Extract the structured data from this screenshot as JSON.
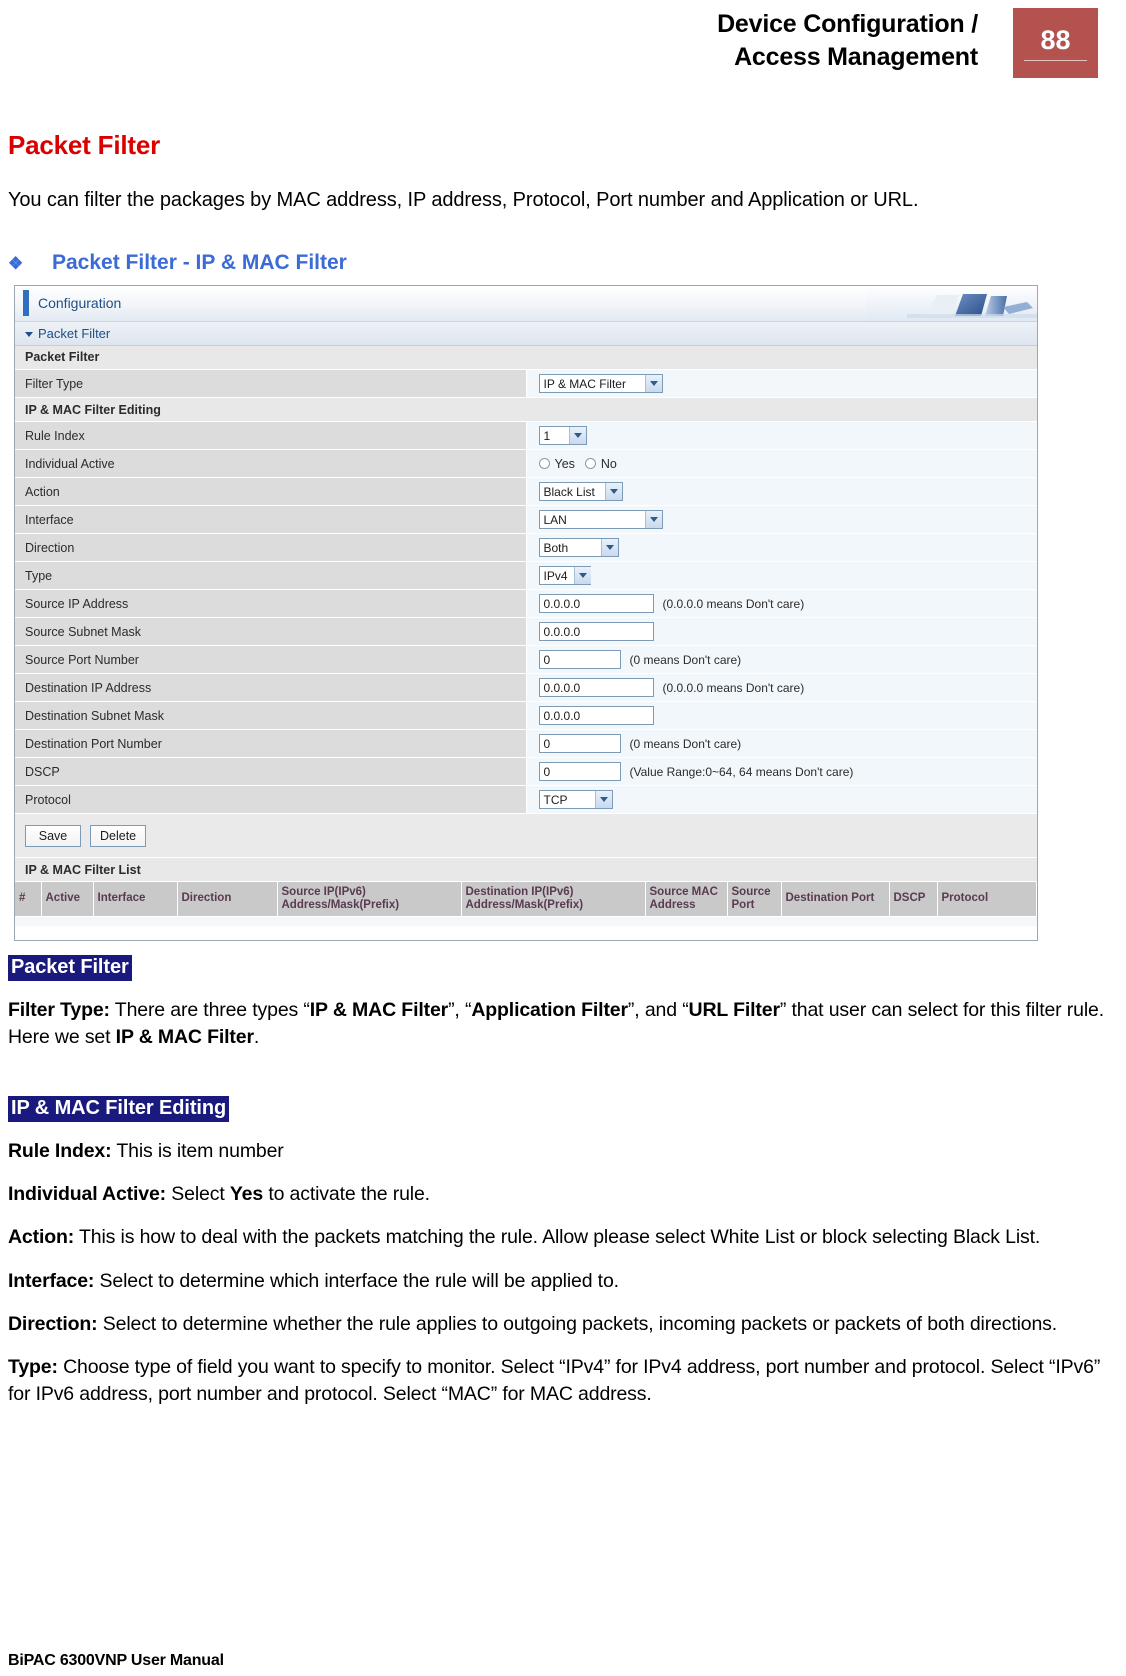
{
  "header": {
    "title": "Device Configuration /\nAccess Management",
    "page_number": "88"
  },
  "section": {
    "title": "Packet Filter",
    "intro": "You can filter the packages by MAC address, IP address, Protocol, Port number and Application or URL.",
    "bullet_marker": "❖",
    "bullet_title": "Packet Filter - IP & MAC Filter"
  },
  "screenshot": {
    "topbar_label": "Configuration",
    "panel_title": "Packet Filter",
    "groups": {
      "packet_filter": "Packet Filter",
      "filter_editing": "IP & MAC Filter Editing",
      "filter_list": "IP & MAC Filter List"
    },
    "rows": {
      "filter_type": {
        "label": "Filter Type",
        "value": "IP & MAC Filter"
      },
      "rule_index": {
        "label": "Rule Index",
        "value": "1"
      },
      "individual_active": {
        "label": "Individual Active",
        "yes": "Yes",
        "no": "No"
      },
      "action": {
        "label": "Action",
        "value": "Black List"
      },
      "interface": {
        "label": "Interface",
        "value": "LAN"
      },
      "direction": {
        "label": "Direction",
        "value": "Both"
      },
      "type": {
        "label": "Type",
        "value": "IPv4"
      },
      "source_ip": {
        "label": "Source IP Address",
        "value": "0.0.0.0",
        "hint": "(0.0.0.0 means Don't care)"
      },
      "source_mask": {
        "label": "Source Subnet Mask",
        "value": "0.0.0.0"
      },
      "source_port": {
        "label": "Source Port Number",
        "value": "0",
        "hint": "(0 means Don't care)"
      },
      "dest_ip": {
        "label": "Destination IP Address",
        "value": "0.0.0.0",
        "hint": "(0.0.0.0 means Don't care)"
      },
      "dest_mask": {
        "label": "Destination Subnet Mask",
        "value": "0.0.0.0"
      },
      "dest_port": {
        "label": "Destination Port Number",
        "value": "0",
        "hint": "(0 means Don't care)"
      },
      "dscp": {
        "label": "DSCP",
        "value": "0",
        "hint": "(Value Range:0~64, 64 means Don't care)"
      },
      "protocol": {
        "label": "Protocol",
        "value": "TCP"
      }
    },
    "buttons": {
      "save": "Save",
      "delete": "Delete"
    },
    "list_columns": [
      "#",
      "Active",
      "Interface",
      "Direction",
      "Source IP(IPv6)\nAddress/Mask(Prefix)",
      "Destination IP(IPv6)\nAddress/Mask(Prefix)",
      "Source MAC\nAddress",
      "Source\nPort",
      "Destination Port",
      "DSCP",
      "Protocol"
    ]
  },
  "descriptions": {
    "heading_packet_filter": "Packet Filter",
    "filter_type": {
      "term": "Filter Type:",
      "text": " There are three types “",
      "b1": "IP & MAC Filter",
      "t2": "”, “",
      "b2": "Application Filter",
      "t3": "”, and “",
      "b3": "URL Filter",
      "t4": "” that user can select for this filter rule. Here we set ",
      "b4": "IP & MAC Filter",
      "t5": "."
    },
    "heading_filter_editing": "IP & MAC Filter Editing",
    "rule_index": {
      "term": "Rule Index:",
      "text": " This is item number"
    },
    "individual_active": {
      "term": "Individual Active:",
      "text": " Select ",
      "b1": "Yes",
      "t2": " to activate the rule."
    },
    "action": {
      "term": "Action:",
      "text": " This is how to deal with the packets matching the rule. Allow please select White List or block selecting Black List."
    },
    "interface": {
      "term": "Interface:",
      "text": " Select to determine which interface the rule will be applied to."
    },
    "direction": {
      "term": "Direction:",
      "text": " Select to determine whether the rule applies to outgoing packets, incoming packets or packets of both directions."
    },
    "type": {
      "term": "Type:",
      "text": " Choose type of field you want to specify to monitor. Select “IPv4” for IPv4 address, port number and protocol. Select “IPv6” for IPv6 address, port number and protocol. Select “MAC” for MAC address."
    }
  },
  "footer": {
    "manual": "BiPAC 6300VNP User Manual"
  },
  "colors": {
    "heading_red": "#d90000",
    "bullet_blue": "#3b6bd6",
    "page_box": "#b4524f",
    "highlight_navy": "#1a1a7e"
  }
}
